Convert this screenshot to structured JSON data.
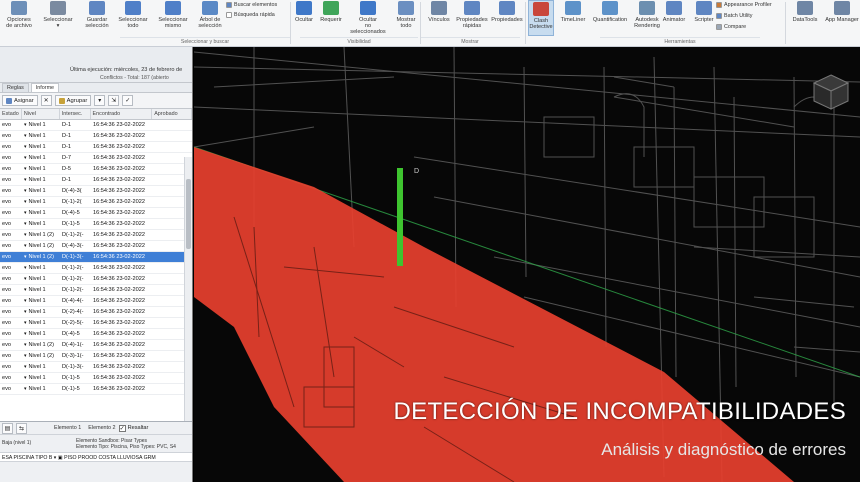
{
  "ribbon": {
    "buttons": [
      {
        "label": "Opciones\nde archivo",
        "color": "#6d8fb8"
      },
      {
        "label": "Seleccionar\n▾",
        "color": "#7a8aa0"
      },
      {
        "label": "Guardar\nselección",
        "color": "#5f86c2"
      },
      {
        "label": "Seleccionar\ntodo",
        "color": "#4f7fc8"
      },
      {
        "label": "Seleccionar\nmismo",
        "color": "#4f7fc8"
      },
      {
        "label": "Árbol de\nselección",
        "color": "#5a89c6"
      },
      {
        "label": "Ocultar",
        "color": "#3f78c8"
      },
      {
        "label": "Requerir",
        "color": "#3fa55a"
      },
      {
        "label": "Ocultar\nno seleccionados",
        "color": "#3f78c8"
      },
      {
        "label": "Mostrar\ntodo",
        "color": "#6b8fc1"
      },
      {
        "label": "Vínculos",
        "color": "#6f86a5"
      },
      {
        "label": "Propiedades\nrápidas",
        "color": "#5f86c2"
      },
      {
        "label": "Propiedades",
        "color": "#5f86c2"
      },
      {
        "label": "Clash\nDetective",
        "color": "#c9473c"
      },
      {
        "label": "TimeLiner",
        "color": "#5d92c9"
      },
      {
        "label": "Quantification",
        "color": "#5d92c9"
      },
      {
        "label": "Autodesk\nRendering",
        "color": "#6c8fb0"
      },
      {
        "label": "Animator",
        "color": "#5f86c2"
      },
      {
        "label": "Scripter",
        "color": "#5f86c2"
      },
      {
        "label": "DataTools",
        "color": "#6f86a5"
      },
      {
        "label": "App Manager",
        "color": "#6f86a5"
      }
    ],
    "small_items": {
      "buscar": "Buscar elementos",
      "busqueda_rapida": "Búsqueda rápida",
      "appearance": "Appearance Profiler",
      "batch": "Batch Utility",
      "compare": "Compare"
    },
    "groups": [
      "Seleccionar y buscar",
      "Visibilidad",
      "Mostrar",
      "Herramientas"
    ]
  },
  "panel": {
    "last_run": "Última ejecución: miércoles, 23 de febrero de",
    "conflicts_line": "Conflictos - Total: 187 (abierto",
    "subtabs": [
      "Reglas",
      "Informe"
    ],
    "toolbar": {
      "assign": "Asignar",
      "group": "Agrupar"
    },
    "columns": [
      "Estado",
      "Nivel",
      "Intersec.",
      "Encontrado",
      "Aprobado"
    ],
    "rows": [
      {
        "status": "evo",
        "level": "Nivel 1",
        "grid": "D-1",
        "found": "16:54:36 23-02-2022"
      },
      {
        "status": "evo",
        "level": "Nivel 1",
        "grid": "D-1",
        "found": "16:54:36 23-02-2022"
      },
      {
        "status": "evo",
        "level": "Nivel 1",
        "grid": "D-1",
        "found": "16:54:36 23-02-2022"
      },
      {
        "status": "evo",
        "level": "Nivel 1",
        "grid": "D-7",
        "found": "16:54:36 23-02-2022"
      },
      {
        "status": "evo",
        "level": "Nivel 1",
        "grid": "D-5",
        "found": "16:54:36 23-02-2022"
      },
      {
        "status": "evo",
        "level": "Nivel 1",
        "grid": "D-1",
        "found": "16:54:36 23-02-2022"
      },
      {
        "status": "evo",
        "level": "Nivel 1",
        "grid": "D(-4)-3(",
        "found": "16:54:36 23-02-2022"
      },
      {
        "status": "evo",
        "level": "Nivel 1",
        "grid": "D(-1)-2(",
        "found": "16:54:36 23-02-2022"
      },
      {
        "status": "evo",
        "level": "Nivel 1",
        "grid": "D(-4)-5",
        "found": "16:54:36 23-02-2022"
      },
      {
        "status": "evo",
        "level": "Nivel 1",
        "grid": "D(-1)-5",
        "found": "16:54:36 23-02-2022"
      },
      {
        "status": "evo",
        "level": "Nivel 1 (2)",
        "grid": "D(-1)-2(-",
        "found": "16:54:36 23-02-2022"
      },
      {
        "status": "evo",
        "level": "Nivel 1 (2)",
        "grid": "D(-4)-3(-",
        "found": "16:54:36 23-02-2022"
      },
      {
        "status": "evo",
        "level": "Nivel 1 (2)",
        "grid": "D(-1)-3(-",
        "found": "16:54:36 23-02-2022",
        "selected": true
      },
      {
        "status": "evo",
        "level": "Nivel 1",
        "grid": "D(-1)-2(-",
        "found": "16:54:36 23-02-2022"
      },
      {
        "status": "evo",
        "level": "Nivel 1",
        "grid": "D(-1)-2(-",
        "found": "16:54:36 23-02-2022"
      },
      {
        "status": "evo",
        "level": "Nivel 1",
        "grid": "D(-1)-2(-",
        "found": "16:54:36 23-02-2022"
      },
      {
        "status": "evo",
        "level": "Nivel 1",
        "grid": "D(-4)-4(-",
        "found": "16:54:36 23-02-2022"
      },
      {
        "status": "evo",
        "level": "Nivel 1",
        "grid": "D(-2)-4(-",
        "found": "16:54:36 23-02-2022"
      },
      {
        "status": "evo",
        "level": "Nivel 1",
        "grid": "D(-2)-5(-",
        "found": "16:54:36 23-02-2022"
      },
      {
        "status": "evo",
        "level": "Nivel 1",
        "grid": "D(-4)-5",
        "found": "16:54:36 23-02-2022"
      },
      {
        "status": "evo",
        "level": "Nivel 1 (2)",
        "grid": "D(-4)-1(-",
        "found": "16:54:36 23-02-2022"
      },
      {
        "status": "evo",
        "level": "Nivel 1 (2)",
        "grid": "D(-3)-1(-",
        "found": "16:54:36 23-02-2022"
      },
      {
        "status": "evo",
        "level": "Nivel 1",
        "grid": "D(-1)-3(-",
        "found": "16:54:36 23-02-2022"
      },
      {
        "status": "evo",
        "level": "Nivel 1",
        "grid": "D(-1)-5",
        "found": "16:54:36 23-02-2022"
      },
      {
        "status": "evo",
        "level": "Nivel 1",
        "grid": "D(-1)-5",
        "found": "16:54:36 23-02-2022"
      }
    ]
  },
  "bottom": {
    "left_label": "Elemento 1",
    "right_label": "Elemento 2",
    "resaltar": "Resaltar",
    "left_info": "Baja (nivel 1)",
    "info_1": "Elemento Sandbox: Pisar Types",
    "info_2": "Elemento Tipo: Piscina, Piso Types: PVC, S4",
    "names": "ESA PISCINA TIPO B  ▾  ▣ PISO PROOD  COSTA LLUVIOSA  GRM"
  },
  "viewport": {
    "title": "DETECCIÓN DE INCOMPATIBILIDADES",
    "subtitle": "Análisis y diagnóstico  de errores",
    "clash_color": "#e8402f",
    "element_color": "#3ec42f",
    "clash_label": "D"
  }
}
